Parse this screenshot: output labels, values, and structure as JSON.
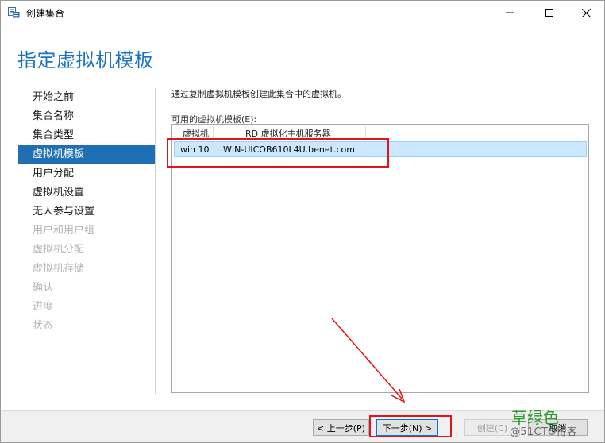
{
  "window": {
    "title": "创建集合",
    "minimize_icon": "minimize-icon",
    "maximize_icon": "maximize-icon",
    "close_icon": "close-icon"
  },
  "page": {
    "heading": "指定虚拟机模板"
  },
  "nav": {
    "items": [
      {
        "label": "开始之前",
        "state": "normal"
      },
      {
        "label": "集合名称",
        "state": "normal"
      },
      {
        "label": "集合类型",
        "state": "normal"
      },
      {
        "label": "虚拟机模板",
        "state": "active"
      },
      {
        "label": "用户分配",
        "state": "normal"
      },
      {
        "label": "虚拟机设置",
        "state": "normal"
      },
      {
        "label": "无人参与设置",
        "state": "normal"
      },
      {
        "label": "用户和用户组",
        "state": "disabled"
      },
      {
        "label": "虚拟机分配",
        "state": "disabled"
      },
      {
        "label": "虚拟机存储",
        "state": "disabled"
      },
      {
        "label": "确认",
        "state": "disabled"
      },
      {
        "label": "进度",
        "state": "disabled"
      },
      {
        "label": "状态",
        "state": "disabled"
      }
    ]
  },
  "content": {
    "description": "通过复制虚拟机模板创建此集合中的虚拟机。",
    "list_label": "可用的虚拟机模板(E):",
    "columns": [
      "虚拟机",
      "RD 虚拟化主机服务器"
    ],
    "rows": [
      {
        "vm": "win 10",
        "server": "WIN-UICOB610L4U.benet.com",
        "selected": true
      }
    ]
  },
  "buttons": {
    "prev": "< 上一步(P)",
    "next": "下一步(N) >",
    "create": "创建(C)",
    "cancel": "取消"
  },
  "watermark": {
    "line1": "草绿色",
    "line2": "@51CTO博客"
  },
  "colors": {
    "accent": "#1e6fb3",
    "heading": "#1e73be",
    "selection": "#cce8ff",
    "annotation": "#e0141b"
  }
}
